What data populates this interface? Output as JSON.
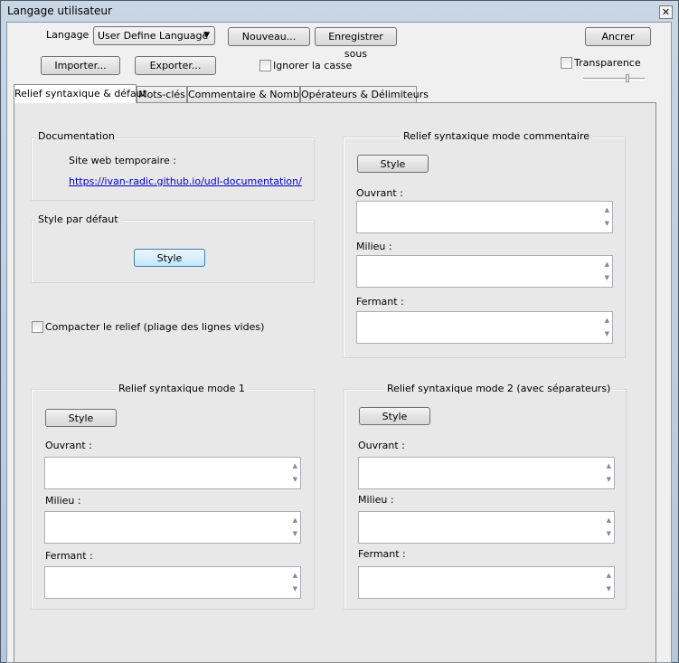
{
  "window": {
    "title": "Langage utilisateur",
    "close_glyph": "✕"
  },
  "toolbar": {
    "language_label": "Langage :",
    "language_value": "User Define Language",
    "new_label": "Nouveau...",
    "save_as_label": "Enregistrer sous",
    "dock_label": "Ancrer",
    "import_label": "Importer...",
    "export_label": "Exporter...",
    "ignore_case_label": "Ignorer la casse",
    "transparency_label": "Transparence"
  },
  "tabs": [
    {
      "label": "Relief syntaxique & défaut"
    },
    {
      "label": "Mots-clés"
    },
    {
      "label": "Commentaire & Nombre"
    },
    {
      "label": "Opérateurs & Délimiteurs"
    }
  ],
  "documentation": {
    "title": "Documentation",
    "site_label": "Site web temporaire :",
    "link": "https://ivan-radic.github.io/udl-documentation/"
  },
  "default_style": {
    "title": "Style par défaut",
    "button": "Style"
  },
  "compact_fold_label": "Compacter le relief (pliage des lignes vides)",
  "comment_mode": {
    "title": "Relief syntaxique mode commentaire",
    "style": "Style",
    "open": "Ouvrant :",
    "middle": "Milieu :",
    "close": "Fermant :"
  },
  "mode1": {
    "title": "Relief syntaxique mode 1",
    "style": "Style",
    "open": "Ouvrant :",
    "middle": "Milieu :",
    "close": "Fermant :"
  },
  "mode2": {
    "title": "Relief syntaxique mode 2 (avec séparateurs)",
    "style": "Style",
    "open": "Ouvrant :",
    "middle": "Milieu :",
    "close": "Fermant :"
  },
  "icons": {
    "dropdown": "▼",
    "scroll_up": "▲",
    "scroll_down": "▼"
  }
}
